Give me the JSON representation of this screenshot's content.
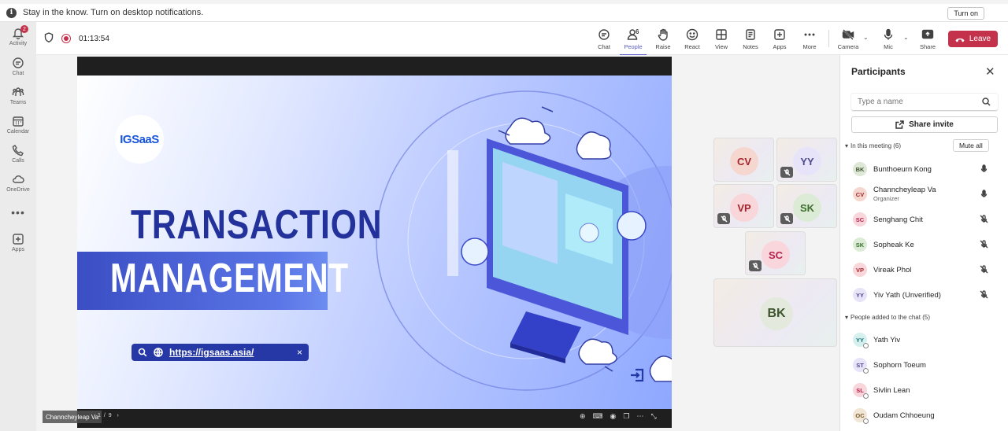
{
  "notification": {
    "message": "Stay in the know. Turn on desktop notifications.",
    "turn_on_label": "Turn on"
  },
  "rail": {
    "activity_badge": "2",
    "items": [
      {
        "label": "Activity",
        "icon": "bell-icon"
      },
      {
        "label": "Chat",
        "icon": "chat-icon"
      },
      {
        "label": "Teams",
        "icon": "teams-icon"
      },
      {
        "label": "Calendar",
        "icon": "calendar-icon"
      },
      {
        "label": "Calls",
        "icon": "phone-icon"
      },
      {
        "label": "OneDrive",
        "icon": "cloud-icon"
      },
      {
        "label": "Apps",
        "icon": "plus-box-icon"
      }
    ],
    "more_label": "•••"
  },
  "toolbar": {
    "timer": "01:13:54",
    "people_count": "6",
    "buttons": {
      "chat": "Chat",
      "people": "People",
      "raise": "Raise",
      "react": "React",
      "view": "View",
      "notes": "Notes",
      "apps": "Apps",
      "more": "More",
      "camera": "Camera",
      "mic": "Mic",
      "share": "Share"
    },
    "leave_label": "Leave",
    "colors": {
      "accent": "#5b5fc7",
      "leave": "#c4314b"
    }
  },
  "slide": {
    "logo_text": "IGSaaS",
    "title_line1": "TRANSACTION",
    "title_line2": "MANAGEMENT",
    "url": "https://igsaas.asia/",
    "url_close": "×",
    "presenter": "Channcheyleap Va",
    "pager": "1 / 9",
    "next": "›"
  },
  "tiles": [
    {
      "initials": "CV",
      "muted": false,
      "bg": "#f6d7cf",
      "fg": "#a4262c"
    },
    {
      "initials": "YY",
      "muted": true,
      "bg": "#e7e4f9",
      "fg": "#4f4a8a"
    },
    {
      "initials": "VP",
      "muted": true,
      "bg": "#f8d6d9",
      "fg": "#a4262c"
    },
    {
      "initials": "SK",
      "muted": true,
      "bg": "#dcebd6",
      "fg": "#3b6e2d"
    },
    {
      "initials": "SC",
      "muted": true,
      "bg": "#f9d5dc",
      "fg": "#b4234c"
    },
    {
      "initials": "BK",
      "muted": false,
      "bg": "#e3e9dc",
      "fg": "#3e5530"
    }
  ],
  "panel": {
    "title": "Participants",
    "search_placeholder": "Type a name",
    "share_invite": "Share invite",
    "in_meeting_label": "In this meeting (6)",
    "mute_all": "Mute all",
    "added_label": "People added to the chat (5)",
    "in_meeting": [
      {
        "initials": "BK",
        "name": "Bunthoeurn Kong",
        "role": "",
        "mic": "on",
        "bg": "#dfe8d7",
        "fg": "#3e5530"
      },
      {
        "initials": "CV",
        "name": "Channcheyleap Va",
        "role": "Organizer",
        "mic": "on",
        "bg": "#f6d7cf",
        "fg": "#a4262c"
      },
      {
        "initials": "SC",
        "name": "Senghang Chit",
        "role": "",
        "mic": "off",
        "bg": "#f9d5dc",
        "fg": "#b4234c"
      },
      {
        "initials": "SK",
        "name": "Sopheak Ke",
        "role": "",
        "mic": "off",
        "bg": "#dcebd6",
        "fg": "#3b6e2d"
      },
      {
        "initials": "VP",
        "name": "Vireak Phol",
        "role": "",
        "mic": "off",
        "bg": "#f8d6d9",
        "fg": "#a4262c"
      },
      {
        "initials": "YY",
        "name": "Yiv Yath (Unverified)",
        "role": "",
        "mic": "off",
        "bg": "#e7e4f9",
        "fg": "#4f4a8a"
      }
    ],
    "added": [
      {
        "initials": "YY",
        "name": "Yath Yiv",
        "bg": "#d6f0f0",
        "fg": "#1b6e6e"
      },
      {
        "initials": "ST",
        "name": "Sophorn Toeum",
        "bg": "#e7e4f9",
        "fg": "#4f4a8a"
      },
      {
        "initials": "SL",
        "name": "Sivlin Lean",
        "bg": "#f9d5dc",
        "fg": "#b4234c"
      },
      {
        "initials": "OC",
        "name": "Oudam Chhoeung",
        "bg": "#f1e6d6",
        "fg": "#7a5a2a"
      }
    ]
  }
}
